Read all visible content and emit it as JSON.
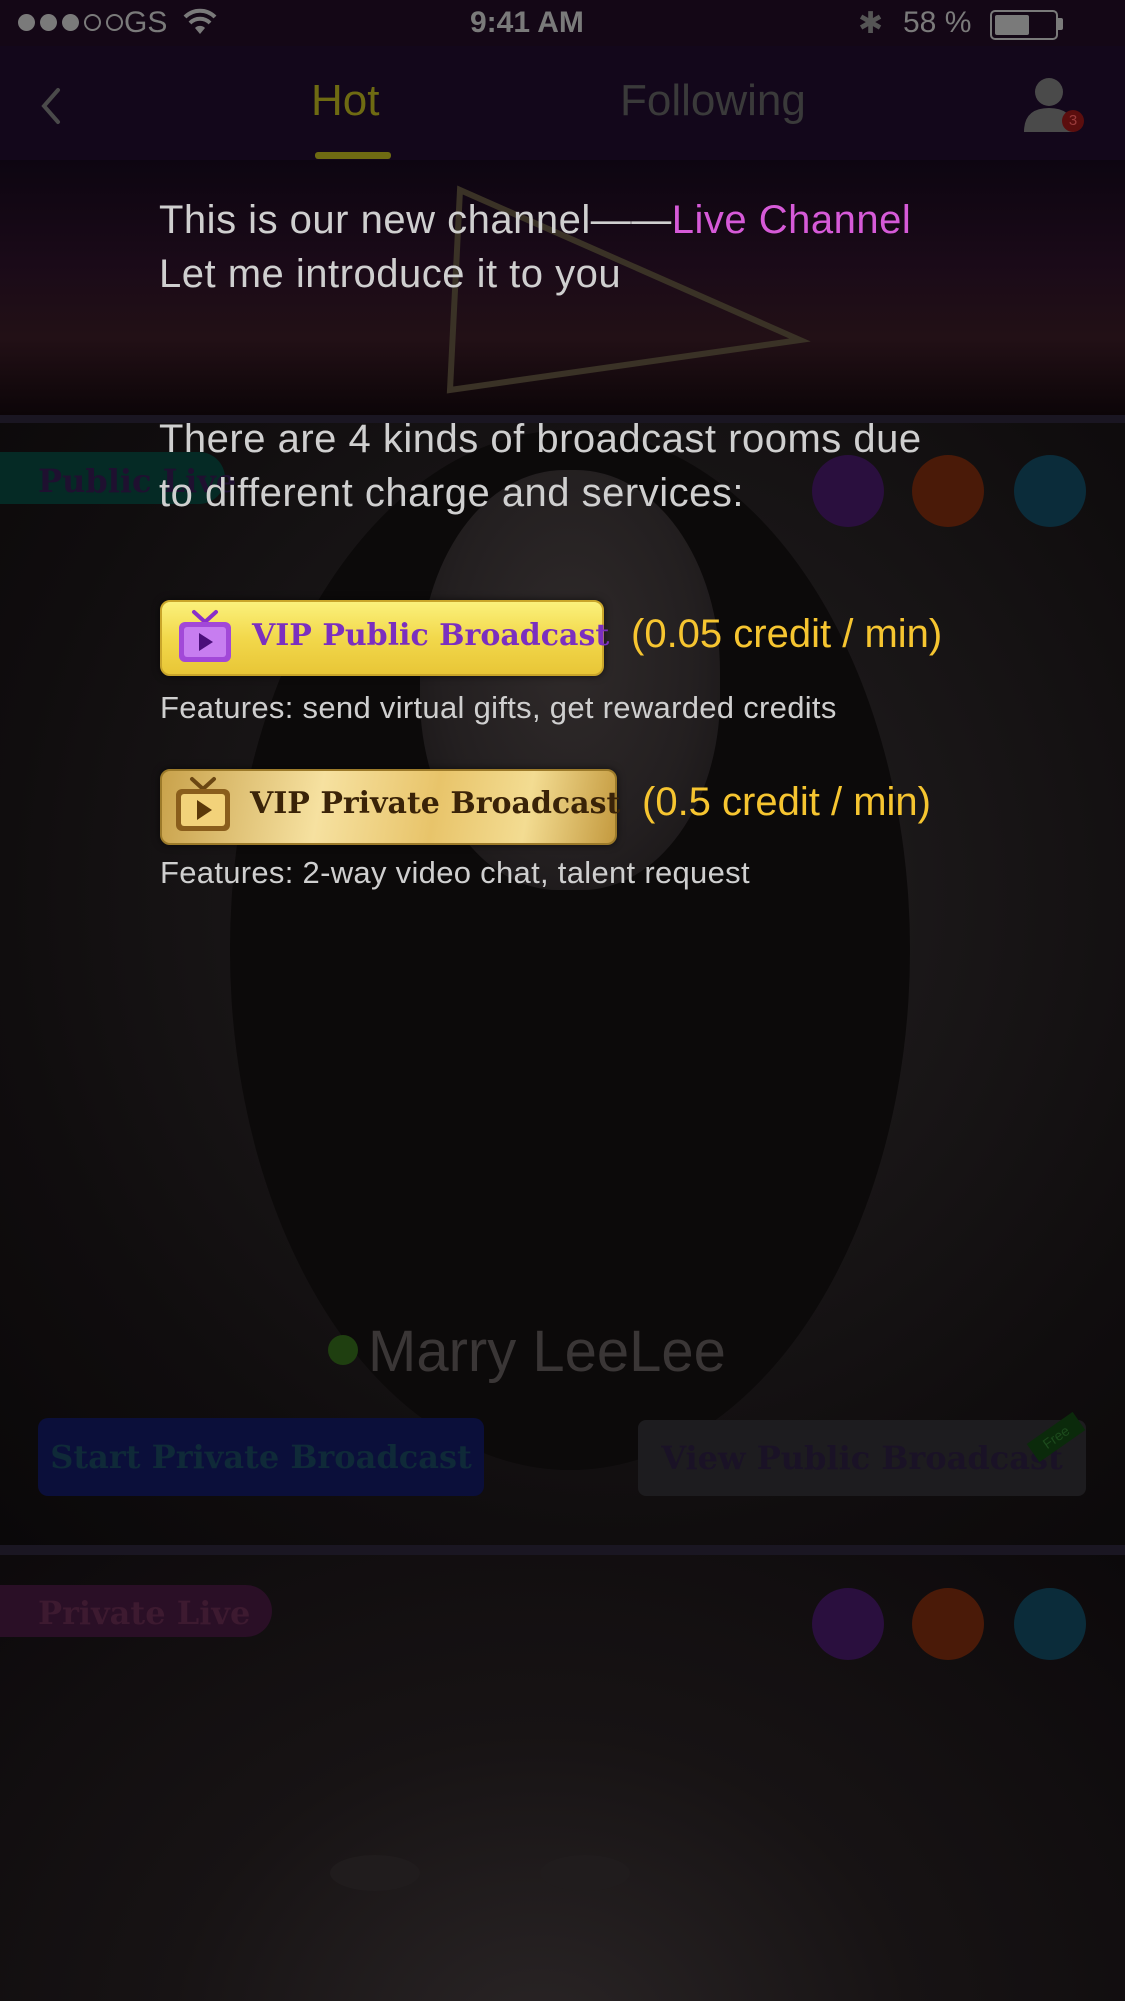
{
  "status_bar": {
    "carrier": "GS",
    "time": "9:41 AM",
    "battery_percent": "58 %",
    "battery_level": 0.58
  },
  "nav": {
    "back_icon": "chevron-left-icon",
    "tabs": [
      {
        "label": "Hot",
        "active": true
      },
      {
        "label": "Following",
        "active": false
      }
    ],
    "profile_icon": "user-icon",
    "profile_badge": "3"
  },
  "feed": {
    "card1": {
      "badge": "Public Live",
      "category_icons": [
        "microphone-icon",
        "utensils-icon",
        "dance-icon"
      ],
      "streamer_name": "Marry LeeLee",
      "start_button": "Start Private Broadcast",
      "view_button": "View Public Broadcast",
      "ribbon": "Free"
    },
    "card2": {
      "badge": "Private Live",
      "category_icons": [
        "microphone-icon",
        "utensils-icon",
        "dance-icon"
      ]
    }
  },
  "intro": {
    "line1_prefix": "This is our new channel——",
    "line1_highlight": "Live Channel",
    "line2": "Let me introduce it to you",
    "line3": "There are 4 kinds of broadcast rooms due",
    "line4": "to different charge and services:",
    "highlight_color": "#d65ad8",
    "price_color": "#f6c530"
  },
  "rooms": [
    {
      "label": "VIP Public Broadcast",
      "price": "(0.05 credit / min)",
      "features": "Features: send virtual gifts, get rewarded credits",
      "icon": "tv-play-icon"
    },
    {
      "label": "VIP Private Broadcast",
      "price": "(0.5 credit / min)",
      "features": "Features: 2-way video chat, talent request",
      "icon": "tv-play-icon"
    }
  ]
}
